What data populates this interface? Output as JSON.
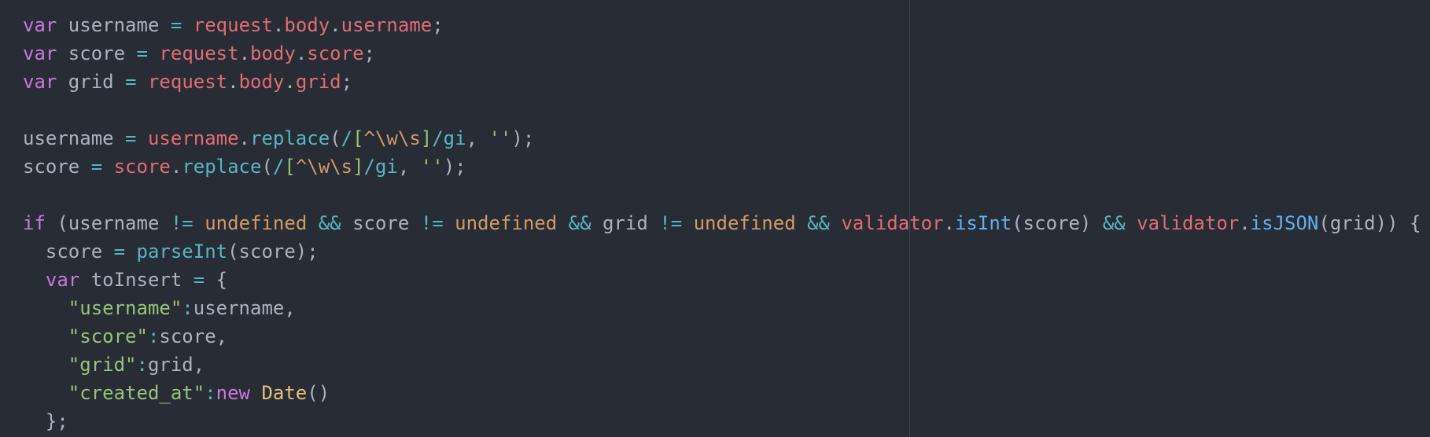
{
  "colors": {
    "background": "#282c34",
    "text": "#abb2bf",
    "keyword": "#c678dd",
    "operator": "#56b6c2",
    "object": "#e06c75",
    "property": "#e06c75",
    "method": "#56b6c2",
    "function": "#61afef",
    "string": "#98c379",
    "constant": "#d19a66",
    "class": "#e5c07b",
    "ruler": "#3e4451"
  },
  "lines": [
    [
      [
        "keyword",
        "var"
      ],
      [
        "plain",
        " username "
      ],
      [
        "operator",
        "="
      ],
      [
        "plain",
        " "
      ],
      [
        "object",
        "request"
      ],
      [
        "punct",
        "."
      ],
      [
        "property",
        "body"
      ],
      [
        "punct",
        "."
      ],
      [
        "property",
        "username"
      ],
      [
        "punct",
        ";"
      ]
    ],
    [
      [
        "keyword",
        "var"
      ],
      [
        "plain",
        " score "
      ],
      [
        "operator",
        "="
      ],
      [
        "plain",
        " "
      ],
      [
        "object",
        "request"
      ],
      [
        "punct",
        "."
      ],
      [
        "property",
        "body"
      ],
      [
        "punct",
        "."
      ],
      [
        "property",
        "score"
      ],
      [
        "punct",
        ";"
      ]
    ],
    [
      [
        "keyword",
        "var"
      ],
      [
        "plain",
        " grid "
      ],
      [
        "operator",
        "="
      ],
      [
        "plain",
        " "
      ],
      [
        "object",
        "request"
      ],
      [
        "punct",
        "."
      ],
      [
        "property",
        "body"
      ],
      [
        "punct",
        "."
      ],
      [
        "property",
        "grid"
      ],
      [
        "punct",
        ";"
      ]
    ],
    [],
    [
      [
        "plain",
        "username "
      ],
      [
        "operator",
        "="
      ],
      [
        "plain",
        " "
      ],
      [
        "object",
        "username"
      ],
      [
        "punct",
        "."
      ],
      [
        "method",
        "replace"
      ],
      [
        "punct",
        "("
      ],
      [
        "regex",
        "/"
      ],
      [
        "regexchar",
        "["
      ],
      [
        "escape",
        "^\\w\\s"
      ],
      [
        "regexchar",
        "]"
      ],
      [
        "regex",
        "/gi"
      ],
      [
        "punct",
        ", "
      ],
      [
        "string",
        "''"
      ],
      [
        "punct",
        ");"
      ]
    ],
    [
      [
        "plain",
        "score "
      ],
      [
        "operator",
        "="
      ],
      [
        "plain",
        " "
      ],
      [
        "object",
        "score"
      ],
      [
        "punct",
        "."
      ],
      [
        "method",
        "replace"
      ],
      [
        "punct",
        "("
      ],
      [
        "regex",
        "/"
      ],
      [
        "regexchar",
        "["
      ],
      [
        "escape",
        "^\\w\\s"
      ],
      [
        "regexchar",
        "]"
      ],
      [
        "regex",
        "/gi"
      ],
      [
        "punct",
        ", "
      ],
      [
        "string",
        "''"
      ],
      [
        "punct",
        ");"
      ]
    ],
    [],
    [
      [
        "keyword",
        "if"
      ],
      [
        "plain",
        " (username "
      ],
      [
        "operator",
        "!="
      ],
      [
        "plain",
        " "
      ],
      [
        "constant",
        "undefined"
      ],
      [
        "plain",
        " "
      ],
      [
        "operator",
        "&&"
      ],
      [
        "plain",
        " score "
      ],
      [
        "operator",
        "!="
      ],
      [
        "plain",
        " "
      ],
      [
        "constant",
        "undefined"
      ],
      [
        "plain",
        " "
      ],
      [
        "operator",
        "&&"
      ],
      [
        "plain",
        " grid "
      ],
      [
        "operator",
        "!="
      ],
      [
        "plain",
        " "
      ],
      [
        "constant",
        "undefined"
      ],
      [
        "plain",
        " "
      ],
      [
        "operator",
        "&&"
      ],
      [
        "plain",
        " "
      ],
      [
        "object",
        "validator"
      ],
      [
        "punct",
        "."
      ],
      [
        "function",
        "isInt"
      ],
      [
        "plain",
        "(score) "
      ],
      [
        "operator",
        "&&"
      ],
      [
        "plain",
        " "
      ],
      [
        "object",
        "validator"
      ],
      [
        "punct",
        "."
      ],
      [
        "function",
        "isJSON"
      ],
      [
        "plain",
        "(grid)) {"
      ]
    ],
    [
      [
        "plain",
        "  score "
      ],
      [
        "operator",
        "="
      ],
      [
        "plain",
        " "
      ],
      [
        "method",
        "parseInt"
      ],
      [
        "plain",
        "(score);"
      ]
    ],
    [
      [
        "plain",
        "  "
      ],
      [
        "keyword",
        "var"
      ],
      [
        "plain",
        " toInsert "
      ],
      [
        "operator",
        "="
      ],
      [
        "plain",
        " {"
      ]
    ],
    [
      [
        "plain",
        "    "
      ],
      [
        "string",
        "\"username\""
      ],
      [
        "operator",
        ":"
      ],
      [
        "plain",
        "username,"
      ]
    ],
    [
      [
        "plain",
        "    "
      ],
      [
        "string",
        "\"score\""
      ],
      [
        "operator",
        ":"
      ],
      [
        "plain",
        "score,"
      ]
    ],
    [
      [
        "plain",
        "    "
      ],
      [
        "string",
        "\"grid\""
      ],
      [
        "operator",
        ":"
      ],
      [
        "plain",
        "grid,"
      ]
    ],
    [
      [
        "plain",
        "    "
      ],
      [
        "string",
        "\"created_at\""
      ],
      [
        "operator",
        ":"
      ],
      [
        "keyword",
        "new"
      ],
      [
        "plain",
        " "
      ],
      [
        "class",
        "Date"
      ],
      [
        "plain",
        "()"
      ]
    ],
    [
      [
        "plain",
        "  };"
      ]
    ]
  ]
}
